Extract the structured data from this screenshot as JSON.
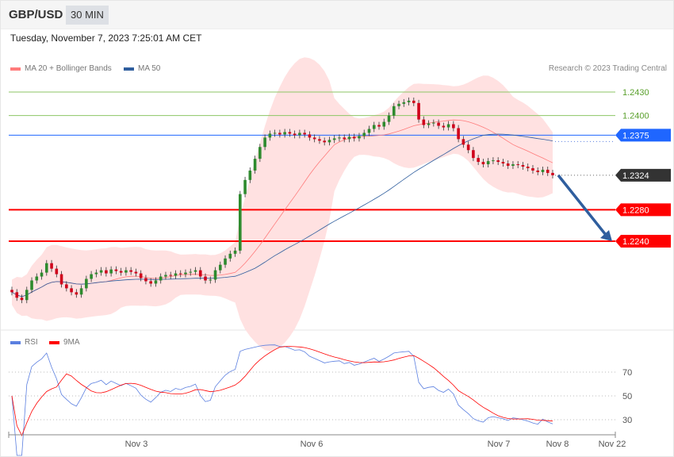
{
  "header": {
    "symbol": "GBP/USD",
    "timeframe": "30 MIN"
  },
  "timestamp": "Tuesday, November 7, 2023 7:25:01 AM CET",
  "legend": {
    "ma20": "MA 20 + Bollinger Bands",
    "ma50": "MA 50",
    "rsi": "RSI",
    "rsi_ma": "9MA"
  },
  "credit": "Research © 2023 Trading Central",
  "colors": {
    "up": "#2e8b2e",
    "down": "#d0021b",
    "ma20": "#ff7b7b",
    "ma50": "#2f5e9e",
    "band": "#ffe1e1",
    "resistance": "#8cc665",
    "pivot": "#1f66ff",
    "support": "#ff0000",
    "last": "#333333",
    "arrow": "#2f5e9e",
    "rsi": "#5b7fe0",
    "rsi_ma": "#ff0000"
  },
  "levels": [
    {
      "value": 1.243,
      "label": "1.2430",
      "type": "resistance"
    },
    {
      "value": 1.24,
      "label": "1.2400",
      "type": "resistance"
    },
    {
      "value": 1.2375,
      "label": "1.2375",
      "type": "pivot"
    },
    {
      "value": 1.2324,
      "label": "1.2324",
      "type": "last"
    },
    {
      "value": 1.228,
      "label": "1.2280",
      "type": "support"
    },
    {
      "value": 1.224,
      "label": "1.2240",
      "type": "support"
    }
  ],
  "rsi_ticks": [
    {
      "value": 70,
      "label": "70"
    },
    {
      "value": 50,
      "label": "50"
    },
    {
      "value": 30,
      "label": "30"
    }
  ],
  "x_labels": [
    "Nov 3",
    "Nov 6",
    "Nov 7",
    "Nov 8",
    "Nov 22"
  ],
  "chart_data": {
    "type": "candlestick",
    "closes": [
      1.2175,
      1.2168,
      1.2165,
      1.2178,
      1.219,
      1.2195,
      1.22,
      1.2212,
      1.2205,
      1.2198,
      1.2185,
      1.218,
      1.2175,
      1.2172,
      1.218,
      1.2192,
      1.2198,
      1.22,
      1.2203,
      1.2199,
      1.2204,
      1.2202,
      1.22,
      1.2203,
      1.2201,
      1.2199,
      1.2193,
      1.2189,
      1.2186,
      1.219,
      1.2195,
      1.2197,
      1.2196,
      1.2199,
      1.2198,
      1.22,
      1.2201,
      1.2203,
      1.2195,
      1.219,
      1.2191,
      1.2203,
      1.221,
      1.2218,
      1.2224,
      1.2228,
      1.23,
      1.2318,
      1.233,
      1.2345,
      1.236,
      1.2372,
      1.2377,
      1.2378,
      1.2376,
      1.2379,
      1.2377,
      1.2375,
      1.2378,
      1.2376,
      1.2372,
      1.237,
      1.2368,
      1.2366,
      1.2369,
      1.2371,
      1.2372,
      1.237,
      1.2373,
      1.2371,
      1.2374,
      1.2378,
      1.2383,
      1.2388,
      1.2386,
      1.2392,
      1.24,
      1.2412,
      1.2415,
      1.2417,
      1.2419,
      1.2416,
      1.2395,
      1.2388,
      1.239,
      1.2391,
      1.2387,
      1.2385,
      1.2389,
      1.2384,
      1.237,
      1.2363,
      1.2356,
      1.2346,
      1.2341,
      1.2338,
      1.2342,
      1.2343,
      1.2341,
      1.2339,
      1.2336,
      1.2338,
      1.2337,
      1.2335,
      1.2333,
      1.233,
      1.2328,
      1.2331,
      1.2327,
      1.2324
    ],
    "forecast": {
      "from": 1.2324,
      "to": 1.224,
      "direction": "down"
    }
  }
}
